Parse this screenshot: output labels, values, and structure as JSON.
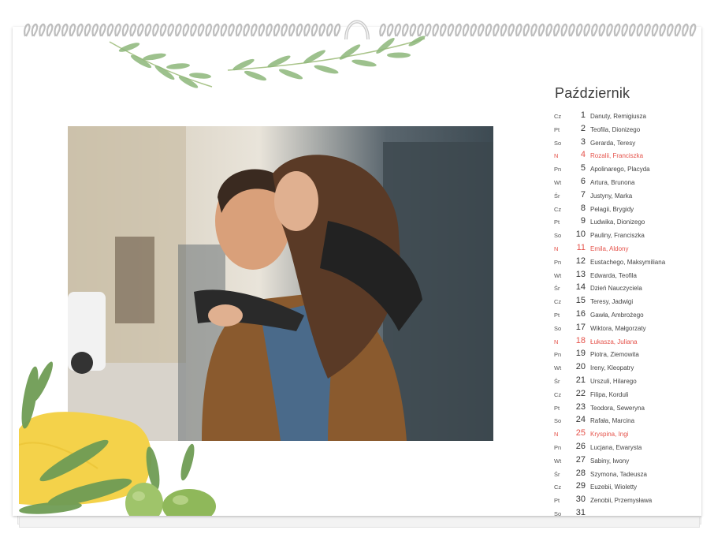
{
  "calendar": {
    "month": "Październik",
    "sunday_color": "#e5534b",
    "days": [
      {
        "wd": "Cz",
        "num": "1",
        "names": "Danuty, Remigiusza",
        "sunday": false
      },
      {
        "wd": "Pt",
        "num": "2",
        "names": "Teofila, Dionizego",
        "sunday": false
      },
      {
        "wd": "So",
        "num": "3",
        "names": "Gerarda, Teresy",
        "sunday": false
      },
      {
        "wd": "N",
        "num": "4",
        "names": "Rozalii, Franciszka",
        "sunday": true
      },
      {
        "wd": "Pn",
        "num": "5",
        "names": "Apolinarego, Placyda",
        "sunday": false
      },
      {
        "wd": "Wt",
        "num": "6",
        "names": "Artura, Brunona",
        "sunday": false
      },
      {
        "wd": "Śr",
        "num": "7",
        "names": "Justyny, Marka",
        "sunday": false
      },
      {
        "wd": "Cz",
        "num": "8",
        "names": "Pelagii, Brygidy",
        "sunday": false
      },
      {
        "wd": "Pt",
        "num": "9",
        "names": "Ludwika, Dionizego",
        "sunday": false
      },
      {
        "wd": "So",
        "num": "10",
        "names": "Pauliny, Franciszka",
        "sunday": false
      },
      {
        "wd": "N",
        "num": "11",
        "names": "Emila, Aldony",
        "sunday": true
      },
      {
        "wd": "Pn",
        "num": "12",
        "names": "Eustachego, Maksymiliana",
        "sunday": false
      },
      {
        "wd": "Wt",
        "num": "13",
        "names": "Edwarda, Teofila",
        "sunday": false
      },
      {
        "wd": "Śr",
        "num": "14",
        "names": "Dzień Nauczyciela",
        "sunday": false
      },
      {
        "wd": "Cz",
        "num": "15",
        "names": "Teresy, Jadwigi",
        "sunday": false
      },
      {
        "wd": "Pt",
        "num": "16",
        "names": "Gawła, Ambrożego",
        "sunday": false
      },
      {
        "wd": "So",
        "num": "17",
        "names": "Wiktora, Małgorzaty",
        "sunday": false
      },
      {
        "wd": "N",
        "num": "18",
        "names": "Łukasza, Juliana",
        "sunday": true
      },
      {
        "wd": "Pn",
        "num": "19",
        "names": "Piotra, Ziemowita",
        "sunday": false
      },
      {
        "wd": "Wt",
        "num": "20",
        "names": "Ireny, Kleopatry",
        "sunday": false
      },
      {
        "wd": "Śr",
        "num": "21",
        "names": "Urszuli, Hilarego",
        "sunday": false
      },
      {
        "wd": "Cz",
        "num": "22",
        "names": "Filipa, Korduli",
        "sunday": false
      },
      {
        "wd": "Pt",
        "num": "23",
        "names": "Teodora, Seweryna",
        "sunday": false
      },
      {
        "wd": "So",
        "num": "24",
        "names": "Rafała, Marcina",
        "sunday": false
      },
      {
        "wd": "N",
        "num": "25",
        "names": "Kryspina, Ingi",
        "sunday": true
      },
      {
        "wd": "Pn",
        "num": "26",
        "names": "Lucjana, Ewarysta",
        "sunday": false
      },
      {
        "wd": "Wt",
        "num": "27",
        "names": "Sabiny, Iwony",
        "sunday": false
      },
      {
        "wd": "Śr",
        "num": "28",
        "names": "Szymona, Tadeusza",
        "sunday": false
      },
      {
        "wd": "Cz",
        "num": "29",
        "names": "Euzebii, Wioletty",
        "sunday": false
      },
      {
        "wd": "Pt",
        "num": "30",
        "names": "Zenobii, Przemysława",
        "sunday": false
      },
      {
        "wd": "So",
        "num": "31",
        "names": "",
        "sunday": false
      }
    ]
  },
  "photo": {
    "subject": "couple-piggyback-photo"
  },
  "decorations": {
    "leaf_color": "#8db77a",
    "lemon_color": "#f4d24a",
    "olive_color": "#9fc46a"
  }
}
